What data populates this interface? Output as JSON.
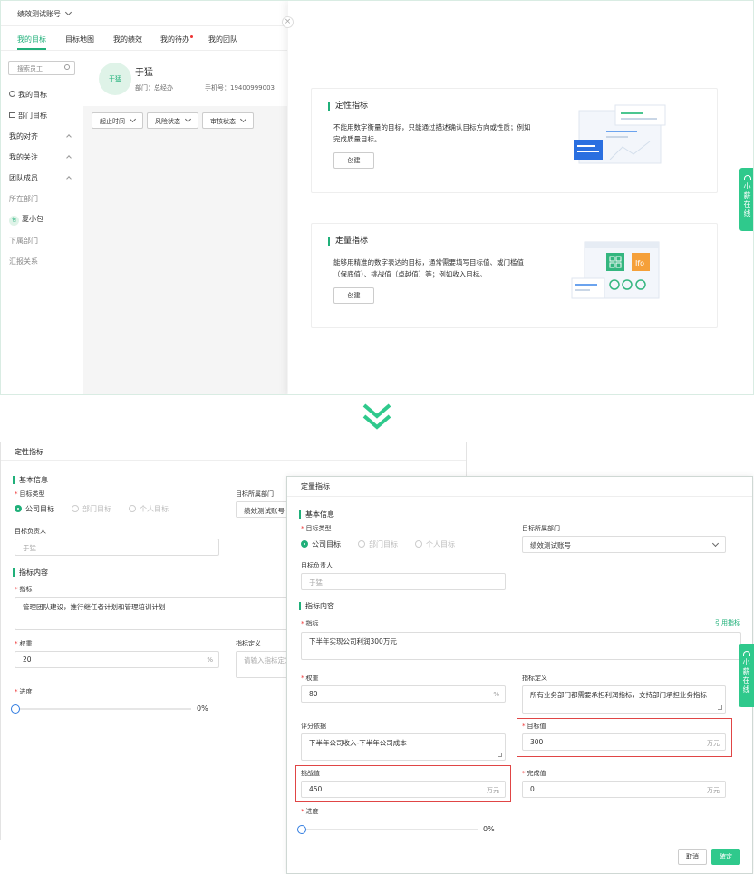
{
  "app": {
    "title": "绩效测试账号"
  },
  "tabs": [
    {
      "label": "我的目标"
    },
    {
      "label": "目标地图"
    },
    {
      "label": "我的绩效"
    },
    {
      "label": "我的待办"
    },
    {
      "label": "我的团队"
    }
  ],
  "sidebar": {
    "search_placeholder": "搜索员工",
    "items": [
      {
        "label": "我的目标"
      },
      {
        "label": "部门目标"
      },
      {
        "label": "我的对齐"
      },
      {
        "label": "我的关注"
      },
      {
        "label": "团队成员"
      },
      {
        "label": "所在部门"
      },
      {
        "label": "夏小包",
        "avatar": "包"
      },
      {
        "label": "下属部门"
      },
      {
        "label": "汇报关系"
      }
    ]
  },
  "profile": {
    "avatar_text": "于猛",
    "name": "于猛",
    "dept": "部门：总经办",
    "phone": "手机号：19400999003"
  },
  "filters": [
    {
      "label": "起止时间"
    },
    {
      "label": "风险状态"
    },
    {
      "label": "审核状态"
    }
  ],
  "cards": [
    {
      "title": "定性指标",
      "desc": "不能用数字衡量的目标，只能通过描述确认目标方向或性质；例如完成质量目标。",
      "button": "创建"
    },
    {
      "title": "定量指标",
      "desc": "能够用精准的数字表达的目标，通常需要填写目标值、或门槛值（保底值）、挑战值（卓越值）等；例如收入目标。",
      "button": "创建"
    }
  ],
  "side_tab": {
    "label": "小薪在线"
  },
  "panelA": {
    "title": "定性指标",
    "section_basic": "基本信息",
    "goal_type_label": "目标类型",
    "radios": [
      "公司目标",
      "部门目标",
      "个人目标"
    ],
    "dept_label": "目标所属部门",
    "dept_value": "绩效测试账号",
    "owner_label": "目标负责人",
    "owner_placeholder": "于猛",
    "section_content": "指标内容",
    "indicator_label": "指标",
    "indicator_value": "管理团队建设，推行继任者计划和管理培训计划",
    "weight_label": "权重",
    "weight_value": "20",
    "weight_unit": "%",
    "definition_label": "指标定义",
    "definition_placeholder": "请输入指标定义",
    "progress_label": "进度",
    "progress_text": "0%",
    "progress": 0
  },
  "panelB": {
    "title": "定量指标",
    "section_basic": "基本信息",
    "goal_type_label": "目标类型",
    "radios": [
      "公司目标",
      "部门目标",
      "个人目标"
    ],
    "dept_label": "目标所属部门",
    "dept_value": "绩效测试账号",
    "owner_label": "目标负责人",
    "owner_placeholder": "于猛",
    "section_content": "指标内容",
    "indicator_label": "指标",
    "quote_link": "引用指标",
    "indicator_value": "下半年实现公司利润300万元",
    "weight_label": "权重",
    "weight_value": "80",
    "weight_unit": "%",
    "definition_label": "指标定义",
    "definition_value": "所有业务部门都需要承担利润指标，支持部门承担业务指标",
    "basis_label": "评分依据",
    "basis_value": "下半年公司收入-下半年公司成本",
    "target_label": "目标值",
    "target_value": "300",
    "unit": "万元",
    "challenge_label": "挑战值",
    "challenge_value": "450",
    "complete_label": "完成值",
    "complete_value": "0",
    "progress_label": "进度",
    "progress_text": "0%",
    "progress": 0,
    "cancel": "取消",
    "confirm": "確定"
  },
  "colors": {
    "accent": "#20b07a",
    "highlight": "#e04545"
  }
}
